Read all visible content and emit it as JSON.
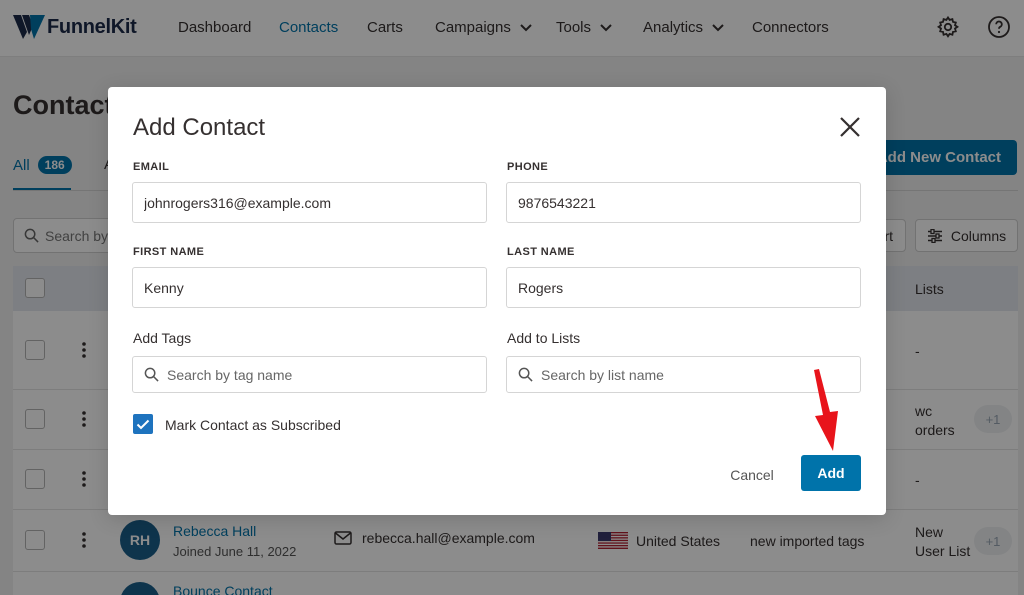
{
  "brand": {
    "name": "FunnelKit"
  },
  "nav": {
    "items": [
      {
        "label": "Dashboard"
      },
      {
        "label": "Contacts"
      },
      {
        "label": "Carts"
      },
      {
        "label": "Campaigns"
      },
      {
        "label": "Tools"
      },
      {
        "label": "Analytics"
      },
      {
        "label": "Connectors"
      }
    ],
    "active": "Contacts",
    "icons": [
      "gear-icon",
      "help-icon"
    ]
  },
  "page": {
    "title": "Contacts",
    "tabs": {
      "all_label": "All",
      "all_count": "186",
      "next_tab_partial": "A"
    },
    "add_new_button": "Add New Contact",
    "search_placeholder": "Search by c",
    "export_partial": "rt",
    "columns_button": "Columns",
    "table": {
      "lists_header": "Lists",
      "rows": [
        {
          "lists": "-"
        },
        {
          "lists_line1": "wc",
          "lists_line2": "orders",
          "extra": "+1"
        },
        {
          "lists": "-"
        },
        {
          "initials": "RH",
          "name": "Rebecca Hall",
          "joined": "Joined June 11, 2022",
          "email": "rebecca.hall@example.com",
          "country": "United States",
          "tags": "new imported tags",
          "lists_line1": "New",
          "lists_line2": "User List",
          "extra": "+1"
        },
        {
          "initials": "BC",
          "name": "Bounce Contact"
        }
      ]
    }
  },
  "modal": {
    "title": "Add Contact",
    "email_label": "EMAIL",
    "email_value": "johnrogers316@example.com",
    "phone_label": "PHONE",
    "phone_value": "9876543221",
    "first_name_label": "FIRST NAME",
    "first_name_value": "Kenny",
    "last_name_label": "LAST NAME",
    "last_name_value": "Rogers",
    "tags_label": "Add Tags",
    "tags_placeholder": "Search by tag name",
    "lists_label": "Add to Lists",
    "lists_placeholder": "Search by list name",
    "subscribed_label": "Mark Contact as Subscribed",
    "subscribed_checked": true,
    "cancel_button": "Cancel",
    "add_button": "Add"
  },
  "colors": {
    "accent": "#0073aa",
    "annotation_arrow": "#e8141b",
    "brand_dark": "#1d2b49"
  }
}
